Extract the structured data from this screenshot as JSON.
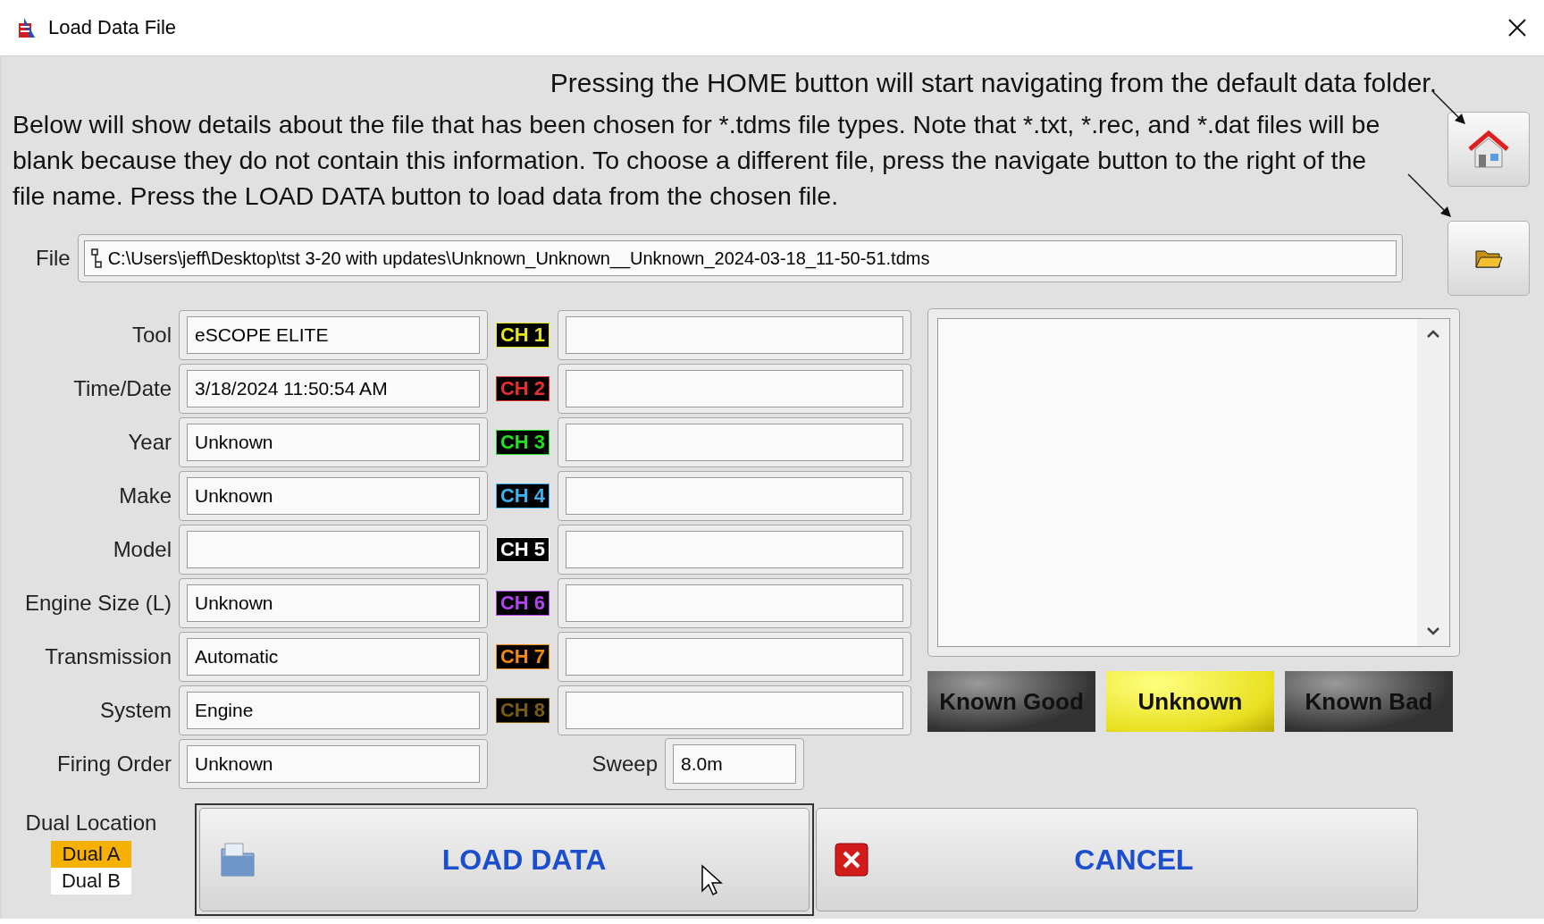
{
  "window": {
    "title": "Load Data File"
  },
  "instructions": {
    "home_note": "Pressing the HOME button will start navigating from the default data folder.",
    "details_note": "Below will show details about the file that has been chosen for *.tdms file types. Note that *.txt, *.rec, and *.dat files will be blank because they do not contain this information. To choose a different file, press the navigate button to the right of the file name. Press the LOAD DATA button to load data from the chosen file."
  },
  "file": {
    "label": "File",
    "value": "C:\\Users\\jeff\\Desktop\\tst 3-20 with updates\\Unknown_Unknown__Unknown_2024-03-18_11-50-51.tdms"
  },
  "fields": [
    {
      "label": "Tool",
      "value": "eSCOPE ELITE"
    },
    {
      "label": "Time/Date",
      "value": "3/18/2024 11:50:54 AM"
    },
    {
      "label": "Year",
      "value": "Unknown"
    },
    {
      "label": "Make",
      "value": "Unknown"
    },
    {
      "label": "Model"
    },
    {
      "label": "Engine Size (L)",
      "value": "Unknown"
    },
    {
      "label": "Transmission",
      "value": "Automatic"
    },
    {
      "label": "System",
      "value": "Engine"
    },
    {
      "label": "Firing Order",
      "value": "Unknown"
    }
  ],
  "channels": [
    {
      "label": "CH 1",
      "color": "#e6e619"
    },
    {
      "label": "CH 2",
      "color": "#e83030"
    },
    {
      "label": "CH 3",
      "color": "#22e022"
    },
    {
      "label": "CH 4",
      "color": "#3ab4f0"
    },
    {
      "label": "CH 5",
      "color": "#ffffff"
    },
    {
      "label": "CH 6",
      "color": "#b444f0"
    },
    {
      "label": "CH 7",
      "color": "#f08a10"
    },
    {
      "label": "CH 8",
      "color": "#7a5c10"
    }
  ],
  "sweep": {
    "label": "Sweep",
    "value": "8.0m"
  },
  "rating_buttons": [
    {
      "label": "Known Good",
      "selected": false
    },
    {
      "label": "Unknown",
      "selected": true
    },
    {
      "label": "Known Bad",
      "selected": false
    }
  ],
  "dual_location": {
    "label": "Dual Location",
    "options": [
      {
        "label": "Dual A",
        "selected": true
      },
      {
        "label": "Dual B",
        "selected": false
      }
    ]
  },
  "actions": [
    {
      "label": "LOAD DATA",
      "kind": "load"
    },
    {
      "label": "CANCEL",
      "kind": "cancel"
    }
  ]
}
